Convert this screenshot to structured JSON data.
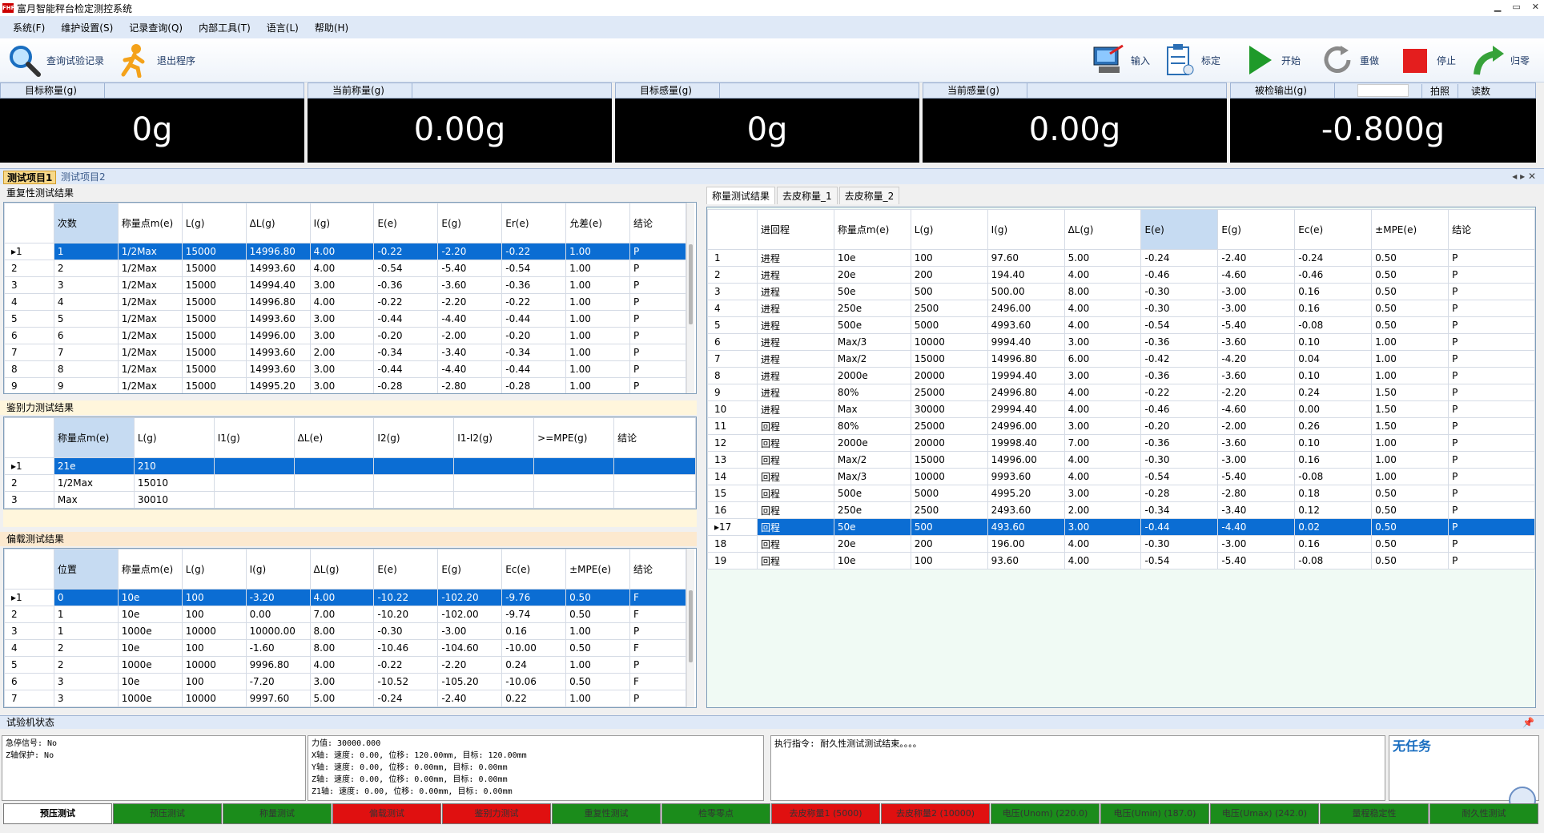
{
  "app": {
    "title": "富月智能秤台检定测控系统",
    "logo": "FHF"
  },
  "menu": [
    "系统(F)",
    "维护设置(S)",
    "记录查询(Q)",
    "内部工具(T)",
    "语言(L)",
    "帮助(H)"
  ],
  "toolbar": {
    "query": "查询试验记录",
    "exit": "退出程序",
    "input": "输入",
    "calibrate": "标定",
    "start": "开始",
    "redo": "重做",
    "stop": "停止",
    "zero": "归零"
  },
  "displays": [
    {
      "label": "目标称量(g)",
      "value": "0g"
    },
    {
      "label": "当前称量(g)",
      "value": "0.00g"
    },
    {
      "label": "目标感量(g)",
      "value": "0g"
    },
    {
      "label": "当前感量(g)",
      "value": "0.00g"
    },
    {
      "label": "被检输出(g)",
      "value": "-0.800g",
      "btn1": "拍照",
      "btn2": "读数"
    }
  ],
  "tabs": [
    "测试项目1",
    "测试项目2"
  ],
  "repeat": {
    "title": "重复性测试结果",
    "cols": [
      "次数",
      "称量点m(e)",
      "L(g)",
      "ΔL(g)",
      "I(g)",
      "E(e)",
      "E(g)",
      "Er(e)",
      "允差(e)",
      "结论"
    ],
    "rows": [
      [
        "1",
        "1/2Max",
        "15000",
        "14996.80",
        "4.00",
        "-0.22",
        "-2.20",
        "-0.22",
        "1.00",
        "P"
      ],
      [
        "2",
        "1/2Max",
        "15000",
        "14993.60",
        "4.00",
        "-0.54",
        "-5.40",
        "-0.54",
        "1.00",
        "P"
      ],
      [
        "3",
        "1/2Max",
        "15000",
        "14994.40",
        "3.00",
        "-0.36",
        "-3.60",
        "-0.36",
        "1.00",
        "P"
      ],
      [
        "4",
        "1/2Max",
        "15000",
        "14996.80",
        "4.00",
        "-0.22",
        "-2.20",
        "-0.22",
        "1.00",
        "P"
      ],
      [
        "5",
        "1/2Max",
        "15000",
        "14993.60",
        "3.00",
        "-0.44",
        "-4.40",
        "-0.44",
        "1.00",
        "P"
      ],
      [
        "6",
        "1/2Max",
        "15000",
        "14996.00",
        "3.00",
        "-0.20",
        "-2.00",
        "-0.20",
        "1.00",
        "P"
      ],
      [
        "7",
        "1/2Max",
        "15000",
        "14993.60",
        "2.00",
        "-0.34",
        "-3.40",
        "-0.34",
        "1.00",
        "P"
      ],
      [
        "8",
        "1/2Max",
        "15000",
        "14993.60",
        "3.00",
        "-0.44",
        "-4.40",
        "-0.44",
        "1.00",
        "P"
      ],
      [
        "9",
        "1/2Max",
        "15000",
        "14995.20",
        "3.00",
        "-0.28",
        "-2.80",
        "-0.28",
        "1.00",
        "P"
      ]
    ]
  },
  "discrim": {
    "title": "鉴别力测试结果",
    "cols": [
      "称量点m(e)",
      "L(g)",
      "I1(g)",
      "ΔL(e)",
      "I2(g)",
      "I1-I2(g)",
      ">=MPE(g)",
      "结论"
    ],
    "rows": [
      [
        "21e",
        "210",
        "",
        "",
        "",
        "",
        "",
        ""
      ],
      [
        "1/2Max",
        "15010",
        "",
        "",
        "",
        "",
        "",
        ""
      ],
      [
        "Max",
        "30010",
        "",
        "",
        "",
        "",
        "",
        ""
      ]
    ]
  },
  "eccentric": {
    "title": "偏载测试结果",
    "cols": [
      "位置",
      "称量点m(e)",
      "L(g)",
      "I(g)",
      "ΔL(g)",
      "E(e)",
      "E(g)",
      "Ec(e)",
      "±MPE(e)",
      "结论"
    ],
    "rows": [
      [
        "0",
        "10e",
        "100",
        "-3.20",
        "4.00",
        "-10.22",
        "-102.20",
        "-9.76",
        "0.50",
        "F"
      ],
      [
        "1",
        "10e",
        "100",
        "0.00",
        "7.00",
        "-10.20",
        "-102.00",
        "-9.74",
        "0.50",
        "F"
      ],
      [
        "1",
        "1000e",
        "10000",
        "10000.00",
        "8.00",
        "-0.30",
        "-3.00",
        "0.16",
        "1.00",
        "P"
      ],
      [
        "2",
        "10e",
        "100",
        "-1.60",
        "8.00",
        "-10.46",
        "-104.60",
        "-10.00",
        "0.50",
        "F"
      ],
      [
        "2",
        "1000e",
        "10000",
        "9996.80",
        "4.00",
        "-0.22",
        "-2.20",
        "0.24",
        "1.00",
        "P"
      ],
      [
        "3",
        "10e",
        "100",
        "-7.20",
        "3.00",
        "-10.52",
        "-105.20",
        "-10.06",
        "0.50",
        "F"
      ],
      [
        "3",
        "1000e",
        "10000",
        "9997.60",
        "5.00",
        "-0.24",
        "-2.40",
        "0.22",
        "1.00",
        "P"
      ]
    ]
  },
  "weigh": {
    "tabs": [
      "称量测试结果",
      "去皮称量_1",
      "去皮称量_2"
    ],
    "cols": [
      "进回程",
      "称量点m(e)",
      "L(g)",
      "I(g)",
      "ΔL(g)",
      "E(e)",
      "E(g)",
      "Ec(e)",
      "±MPE(e)",
      "结论"
    ],
    "rows": [
      [
        "进程",
        "10e",
        "100",
        "97.60",
        "5.00",
        "-0.24",
        "-2.40",
        "-0.24",
        "0.50",
        "P"
      ],
      [
        "进程",
        "20e",
        "200",
        "194.40",
        "4.00",
        "-0.46",
        "-4.60",
        "-0.46",
        "0.50",
        "P"
      ],
      [
        "进程",
        "50e",
        "500",
        "500.00",
        "8.00",
        "-0.30",
        "-3.00",
        "0.16",
        "0.50",
        "P"
      ],
      [
        "进程",
        "250e",
        "2500",
        "2496.00",
        "4.00",
        "-0.30",
        "-3.00",
        "0.16",
        "0.50",
        "P"
      ],
      [
        "进程",
        "500e",
        "5000",
        "4993.60",
        "4.00",
        "-0.54",
        "-5.40",
        "-0.08",
        "0.50",
        "P"
      ],
      [
        "进程",
        "Max/3",
        "10000",
        "9994.40",
        "3.00",
        "-0.36",
        "-3.60",
        "0.10",
        "1.00",
        "P"
      ],
      [
        "进程",
        "Max/2",
        "15000",
        "14996.80",
        "6.00",
        "-0.42",
        "-4.20",
        "0.04",
        "1.00",
        "P"
      ],
      [
        "进程",
        "2000e",
        "20000",
        "19994.40",
        "3.00",
        "-0.36",
        "-3.60",
        "0.10",
        "1.00",
        "P"
      ],
      [
        "进程",
        "80%",
        "25000",
        "24996.80",
        "4.00",
        "-0.22",
        "-2.20",
        "0.24",
        "1.50",
        "P"
      ],
      [
        "进程",
        "Max",
        "30000",
        "29994.40",
        "4.00",
        "-0.46",
        "-4.60",
        "0.00",
        "1.50",
        "P"
      ],
      [
        "回程",
        "80%",
        "25000",
        "24996.00",
        "3.00",
        "-0.20",
        "-2.00",
        "0.26",
        "1.50",
        "P"
      ],
      [
        "回程",
        "2000e",
        "20000",
        "19998.40",
        "7.00",
        "-0.36",
        "-3.60",
        "0.10",
        "1.00",
        "P"
      ],
      [
        "回程",
        "Max/2",
        "15000",
        "14996.00",
        "4.00",
        "-0.30",
        "-3.00",
        "0.16",
        "1.00",
        "P"
      ],
      [
        "回程",
        "Max/3",
        "10000",
        "9993.60",
        "4.00",
        "-0.54",
        "-5.40",
        "-0.08",
        "1.00",
        "P"
      ],
      [
        "回程",
        "500e",
        "5000",
        "4995.20",
        "3.00",
        "-0.28",
        "-2.80",
        "0.18",
        "0.50",
        "P"
      ],
      [
        "回程",
        "250e",
        "2500",
        "2493.60",
        "2.00",
        "-0.34",
        "-3.40",
        "0.12",
        "0.50",
        "P"
      ],
      [
        "回程",
        "50e",
        "500",
        "493.60",
        "3.00",
        "-0.44",
        "-4.40",
        "0.02",
        "0.50",
        "P"
      ],
      [
        "回程",
        "20e",
        "200",
        "196.00",
        "4.00",
        "-0.30",
        "-3.00",
        "0.16",
        "0.50",
        "P"
      ],
      [
        "回程",
        "10e",
        "100",
        "93.60",
        "4.00",
        "-0.54",
        "-5.40",
        "-0.08",
        "0.50",
        "P"
      ]
    ]
  },
  "status": {
    "title": "试验机状态",
    "box1": "急停信号: No\nZ轴保护: No",
    "box2": "力值: 30000.000\nX轴: 速度: 0.00, 位移: 120.00mm, 目标: 120.00mm\nY轴: 速度: 0.00, 位移: 0.00mm, 目标: 0.00mm\nZ轴: 速度: 0.00, 位移: 0.00mm, 目标: 0.00mm\nZ1轴: 速度: 0.00, 位移: 0.00mm, 目标: 0.00mm",
    "box3": "执行指令: 耐久性测试测试结束。。。。",
    "task": "无任务"
  },
  "testbtns": [
    {
      "label": "预压测试",
      "state": "w"
    },
    {
      "label": "预压测试",
      "state": "g"
    },
    {
      "label": "称量测试",
      "state": "g"
    },
    {
      "label": "偏载测试",
      "state": "r"
    },
    {
      "label": "鉴别力测试",
      "state": "r"
    },
    {
      "label": "重复性测试",
      "state": "g"
    },
    {
      "label": "检零零点",
      "state": "g"
    },
    {
      "label": "去皮称量1 (5000)",
      "state": "r"
    },
    {
      "label": "去皮称量2 (10000)",
      "state": "r"
    },
    {
      "label": "电压(Unom) (220.0)",
      "state": "g"
    },
    {
      "label": "电压(Umin) (187.0)",
      "state": "g"
    },
    {
      "label": "电压(Umax) (242.0)",
      "state": "g"
    },
    {
      "label": "量程稳定性",
      "state": "g"
    },
    {
      "label": "耐久性测试",
      "state": "g"
    }
  ],
  "colors": {
    "selected": "#0b6dd3",
    "pass_btn": "#1b8c1b",
    "fail_btn": "#e01010",
    "header_bg": "#dfe9f7"
  }
}
